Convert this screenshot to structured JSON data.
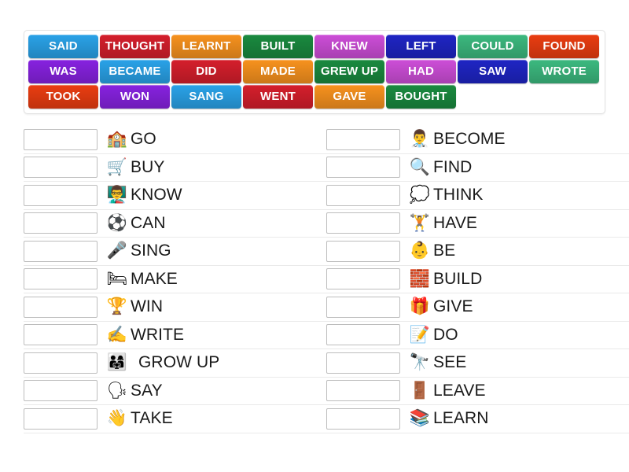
{
  "wordbank": {
    "rows": [
      [
        {
          "label": "SAID",
          "color": "#2aa2e8"
        },
        {
          "label": "THOUGHT",
          "color": "#d51f2c"
        },
        {
          "label": "LEARNT",
          "color": "#f7921e"
        },
        {
          "label": "BUILT",
          "color": "#1a8a3f"
        },
        {
          "label": "KNEW",
          "color": "#cd4ed8"
        },
        {
          "label": "LEFT",
          "color": "#1f25c4"
        },
        {
          "label": "COULD",
          "color": "#3cb97f"
        },
        {
          "label": "FOUND",
          "color": "#ea3d11"
        }
      ],
      [
        {
          "label": "WAS",
          "color": "#8722e0"
        },
        {
          "label": "BECAME",
          "color": "#2aa2e8"
        },
        {
          "label": "DID",
          "color": "#d51f2c"
        },
        {
          "label": "MADE",
          "color": "#f7921e"
        },
        {
          "label": "GREW UP",
          "color": "#1a8a3f"
        },
        {
          "label": "HAD",
          "color": "#cd4ed8"
        },
        {
          "label": "SAW",
          "color": "#1f25c4"
        },
        {
          "label": "WROTE",
          "color": "#3cb97f"
        }
      ],
      [
        {
          "label": "TOOK",
          "color": "#ea3d11"
        },
        {
          "label": "WON",
          "color": "#8722e0"
        },
        {
          "label": "SANG",
          "color": "#2aa2e8"
        },
        {
          "label": "WENT",
          "color": "#d51f2c"
        },
        {
          "label": "GAVE",
          "color": "#f7921e"
        },
        {
          "label": "BOUGHT",
          "color": "#1a8a3f"
        }
      ]
    ]
  },
  "left_column": [
    {
      "label": "GO",
      "answer": "",
      "icon": "school-house-children-icon",
      "glyph": "🏫"
    },
    {
      "label": "BUY",
      "answer": "",
      "icon": "child-shopping-icon",
      "glyph": "🛒"
    },
    {
      "label": "KNOW",
      "answer": "",
      "icon": "children-desks-icon",
      "glyph": "👨‍🏫"
    },
    {
      "label": "CAN",
      "answer": "",
      "icon": "children-soccer-photo",
      "glyph": "⚽"
    },
    {
      "label": "SING",
      "answer": "",
      "icon": "girl-singing-icon",
      "glyph": "🎤"
    },
    {
      "label": "MAKE",
      "answer": "",
      "icon": "making-bed-icon",
      "glyph": "🛏"
    },
    {
      "label": "WIN",
      "answer": "",
      "icon": "children-winning-icon",
      "glyph": "🏆"
    },
    {
      "label": "WRITE",
      "answer": "",
      "icon": "hand-writing-photo",
      "glyph": "✍"
    },
    {
      "label": "GROW UP",
      "answer": "",
      "icon": "family-growing-icon",
      "glyph": "👨‍👩‍👧"
    },
    {
      "label": "SAY",
      "answer": "",
      "icon": "face-speaking-icon",
      "glyph": "🗣"
    },
    {
      "label": "TAKE",
      "answer": "",
      "icon": "cartoon-taking-icon",
      "glyph": "👋"
    }
  ],
  "right_column": [
    {
      "label": "BECOME",
      "answer": "",
      "icon": "boy-becoming-doctor-icon",
      "glyph": "👨‍⚕"
    },
    {
      "label": "FIND",
      "answer": "",
      "icon": "treasure-find-icon",
      "glyph": "🔍"
    },
    {
      "label": "THINK",
      "answer": "",
      "icon": "thinking-face-bubble-icon",
      "glyph": "💭"
    },
    {
      "label": "HAVE",
      "answer": "",
      "icon": "person-lifting-icon",
      "glyph": "🏋"
    },
    {
      "label": "BE",
      "answer": "",
      "icon": "mother-baby-icon",
      "glyph": "👶"
    },
    {
      "label": "BUILD",
      "answer": "",
      "icon": "building-blocks-photo",
      "glyph": "🧱"
    },
    {
      "label": "GIVE",
      "answer": "",
      "icon": "hands-giving-gift-photo",
      "glyph": "🎁"
    },
    {
      "label": "DO",
      "answer": "",
      "icon": "girl-homework-photo",
      "glyph": "📝"
    },
    {
      "label": "SEE",
      "answer": "",
      "icon": "man-binoculars-icon",
      "glyph": "🔭"
    },
    {
      "label": "LEAVE",
      "answer": "",
      "icon": "boy-leaving-door-photo",
      "glyph": "🚪"
    },
    {
      "label": "LEARN",
      "answer": "",
      "icon": "children-learning-photo",
      "glyph": "📚"
    }
  ]
}
